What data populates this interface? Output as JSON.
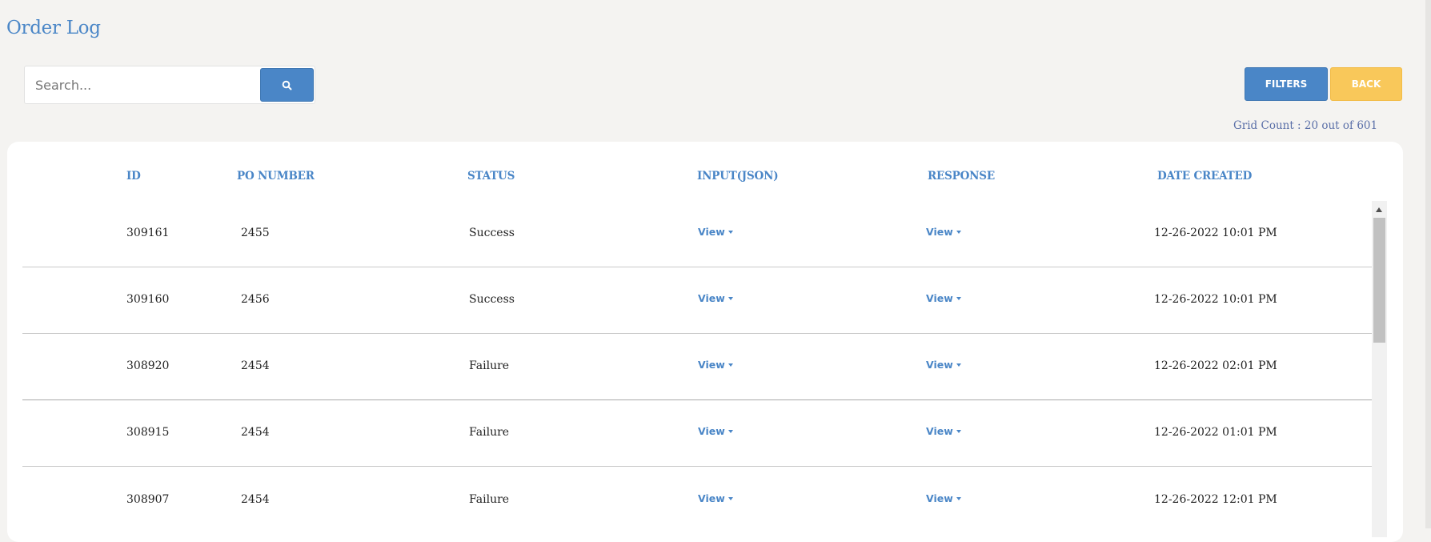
{
  "page": {
    "title": "Order Log",
    "grid_count": "Grid Count : 20 out of 601"
  },
  "search": {
    "placeholder": "Search...",
    "value": "",
    "button_icon": "search-icon"
  },
  "toolbar": {
    "filters_label": "FILTERS",
    "back_label": "BACK"
  },
  "colors": {
    "primary": "#4a86c7",
    "warning": "#f9c85a",
    "background": "#f4f3f1"
  },
  "table": {
    "headers": {
      "id": "ID",
      "po_number": "PO NUMBER",
      "status": "STATUS",
      "input": "INPUT(JSON)",
      "response": "RESPONSE",
      "date_created": "DATE CREATED"
    },
    "view_label": "View",
    "rows": [
      {
        "id": "309161",
        "po": "2455",
        "status": "Success",
        "date": "12-26-2022 10:01 PM"
      },
      {
        "id": "309160",
        "po": "2456",
        "status": "Success",
        "date": "12-26-2022 10:01 PM"
      },
      {
        "id": "308920",
        "po": "2454",
        "status": "Failure",
        "date": "12-26-2022 02:01 PM"
      },
      {
        "id": "308915",
        "po": "2454",
        "status": "Failure",
        "date": "12-26-2022 01:01 PM"
      },
      {
        "id": "308907",
        "po": "2454",
        "status": "Failure",
        "date": "12-26-2022 12:01 PM"
      }
    ]
  }
}
